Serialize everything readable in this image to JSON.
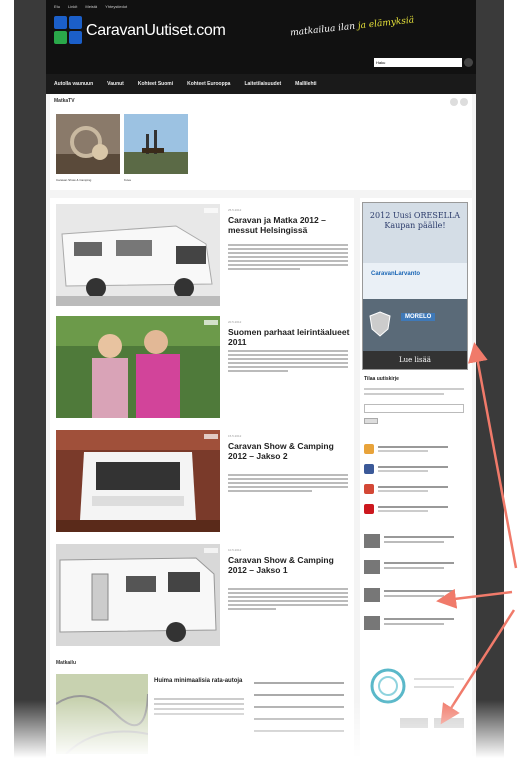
{
  "header": {
    "top_links": [
      "Etu",
      "Linkit",
      "Meistä",
      "Yhteystiedot"
    ],
    "logo_text": "CaravanUutiset.com",
    "slogan_a": "matkailua",
    "slogan_b": "ilan",
    "slogan_c": "ja",
    "slogan_d": "elämyksiä",
    "search_value": "Haku",
    "nav_items": [
      "Autolla vaunuun",
      "Vaunut",
      "Kohteet Suomi",
      "Kohteet Eurooppa",
      "Laitetilaisuudet",
      "Mallilehti"
    ]
  },
  "tv": {
    "title": "MatkaTV",
    "items": [
      {
        "caption": "Caravan Show & Camping"
      },
      {
        "caption": "Kuva"
      }
    ]
  },
  "articles": [
    {
      "date": "25.5.2012",
      "title": "Caravan ja Matka 2012 –messut Helsingissä"
    },
    {
      "date": "20.5.2012",
      "title": "Suomen parhaat leirintäalueet 2011"
    },
    {
      "date": "15.5.2012",
      "title": "Caravan Show & Camping 2012 – Jakso 2"
    },
    {
      "date": "10.5.2012",
      "title": "Caravan Show & Camping 2012 – Jakso 1"
    }
  ],
  "sidebar": {
    "ad_headline": "2012 Uusi ORESELLA Kaupan päälle!",
    "ad_brand": "CaravanLarvanto",
    "ad_model": "MORELO",
    "ad_button": "Lue lisää",
    "newsletter_title": "Tilaa uutiskirje",
    "social": [
      {
        "name": "Tilaa uutiskirjeesi",
        "color": "#e8a33a"
      },
      {
        "name": "Matkailu ystävät Facebookissa",
        "color": "#3b5998"
      },
      {
        "name": "Matkailu ystävät Googlessa",
        "color": "#d34836"
      },
      {
        "name": "CaravanUutiset.com TV",
        "color": "#cc181e"
      }
    ]
  },
  "news": {
    "label": "Matkailu",
    "headline": "Huima minimaalisia rata-autoja"
  },
  "colors": {
    "header_bg": "#111111",
    "accent_blue": "#1b5fc9",
    "arrow": "#f07a6a"
  }
}
